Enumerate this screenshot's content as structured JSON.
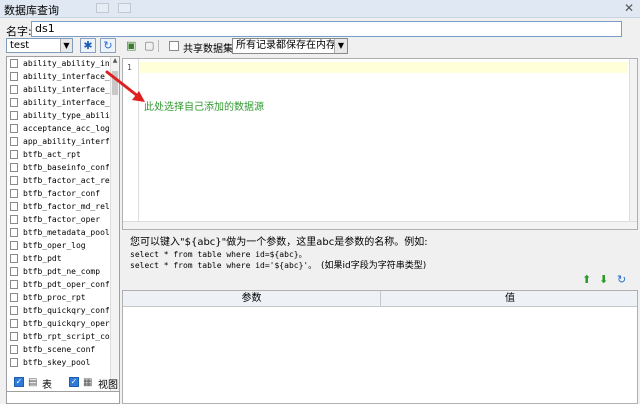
{
  "window": {
    "title": "数据库查询"
  },
  "name_field": {
    "label": "名字:",
    "value": "ds1"
  },
  "db_select": {
    "value": "test"
  },
  "tables": [
    "ability_ability_inter",
    "ability_interface_at",
    "ability_interface_me",
    "ability_interface_ms",
    "ability_type_ability_",
    "acceptance_acc_log",
    "app_ability_interfac",
    "btfb_act_rpt",
    "btfb_baseinfo_conf",
    "btfb_factor_act_rel",
    "btfb_factor_conf",
    "btfb_factor_md_rel",
    "btfb_factor_oper",
    "btfb_metadata_pool",
    "btfb_oper_log",
    "btfb_pdt",
    "btfb_pdt_ne_comp",
    "btfb_pdt_oper_conf",
    "btfb_proc_rpt",
    "btfb_quickqry_conf",
    "btfb_quickqry_oper_c",
    "btfb_rpt_script_conf",
    "btfb_scene_conf",
    "btfb_skey_pool"
  ],
  "filters": {
    "table_label": "表",
    "view_label": "视图"
  },
  "toolbar": {
    "share_label": "共享数据集",
    "mode_value": "所有记录都保存在内存中"
  },
  "editor": {
    "line_number": "1"
  },
  "annotation": "此处选择自己添加的数据源",
  "help": {
    "line1": "您可以键入\"${abc}\"做为一个参数，这里abc是参数的名称。例如:",
    "line2": "select * from table where id=${abc}。",
    "line3_code": "select * from table where id='${abc}'。",
    "line3_note": "(如果id字段为字符串类型)"
  },
  "param_table": {
    "col_param": "参数",
    "col_value": "值"
  },
  "colors": {
    "annotation": "#2e9a2e",
    "arrow": "#e02020",
    "accent": "#2f7ad6"
  }
}
